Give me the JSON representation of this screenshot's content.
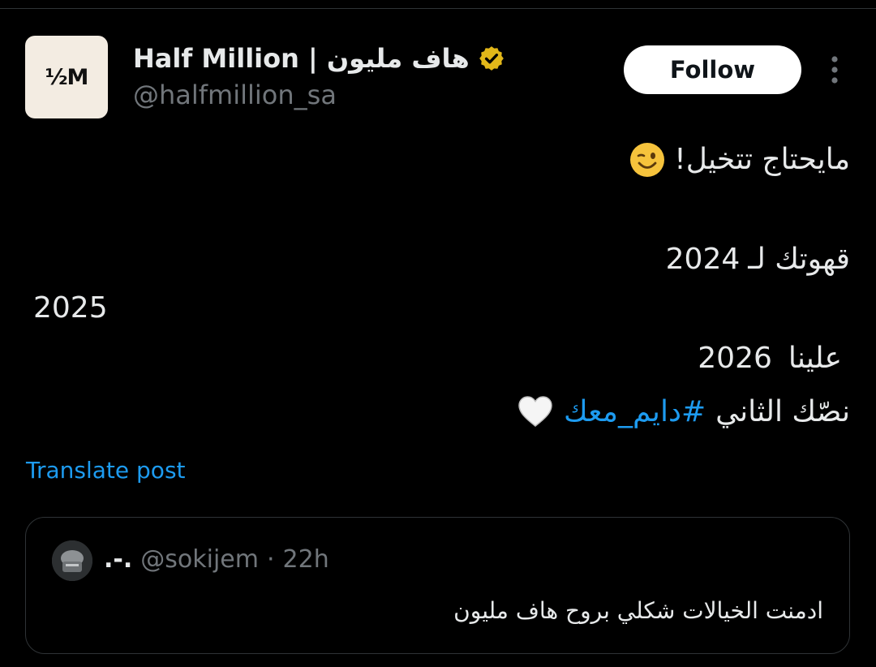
{
  "account": {
    "avatar_text": "½M",
    "display_name": "Half Million | هاف مليون",
    "handle": "@halfmillion_sa",
    "verified_icon": "gold-verified-badge"
  },
  "actions": {
    "follow_label": "Follow",
    "more_icon": "vertical-ellipsis-icon"
  },
  "tweet": {
    "line1": "مايحتاج تتخيل!",
    "line1_emoji": "winking-face",
    "line2_text": "قهوتك لـ",
    "line2_year": "2024",
    "line3_year": "2025",
    "line4_year": "2026",
    "line4_text": "علينا",
    "line5_text": "نصّك الثاني",
    "hashtag": "#دايم_معك",
    "line5_emoji": "white-heart"
  },
  "translate_label": "Translate post",
  "quote": {
    "name": ".-.",
    "handle": "@sokijem",
    "separator": "·",
    "time": "22h",
    "text": "ادمنت الخيالات شكلي بروح هاف مليون"
  },
  "colors": {
    "background": "#000000",
    "text": "#e7e9ea",
    "muted": "#71767b",
    "link": "#1d9bf0",
    "border": "#2f3336",
    "verified": "#e2b719"
  }
}
